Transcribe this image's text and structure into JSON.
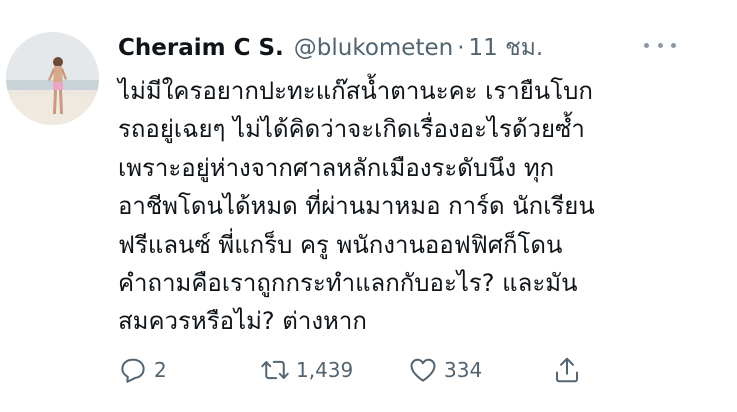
{
  "tweet": {
    "display_name": "Cheraim C S.",
    "handle": "@blukometen",
    "separator": "·",
    "time": "11 ชม.",
    "text": "ไม่มีใครอยากปะทะแก๊สน้ำตานะคะ เรายืนโบก\nรถอยู่เฉยๆ ไม่ได้คิดว่าจะเกิดเรื่องอะไรด้วยซ้ำ\nเพราะอยู่ห่างจากศาลหลักเมืองระดับนึง ทุก\nอาชีพโดนได้หมด ที่ผ่านมาหมอ การ์ด นักเรียน\nฟรีแลนซ์ พี่แกร็บ ครู พนักงานออฟฟิศก็โดน\nคำถามคือเราถูกกระทำแลกกับอะไร? และมัน\nสมควรหรือไม่? ต่างหาก",
    "more_icon": "more-horizontal-icon",
    "actions": {
      "reply": {
        "icon": "reply-icon",
        "count": "2"
      },
      "retweet": {
        "icon": "retweet-icon",
        "count": "1,439"
      },
      "like": {
        "icon": "heart-icon",
        "count": "334"
      },
      "share": {
        "icon": "share-icon"
      }
    }
  },
  "colors": {
    "text_primary": "#0f1419",
    "text_secondary": "#536471",
    "icon_gray": "#8b98a5",
    "background": "#ffffff"
  }
}
